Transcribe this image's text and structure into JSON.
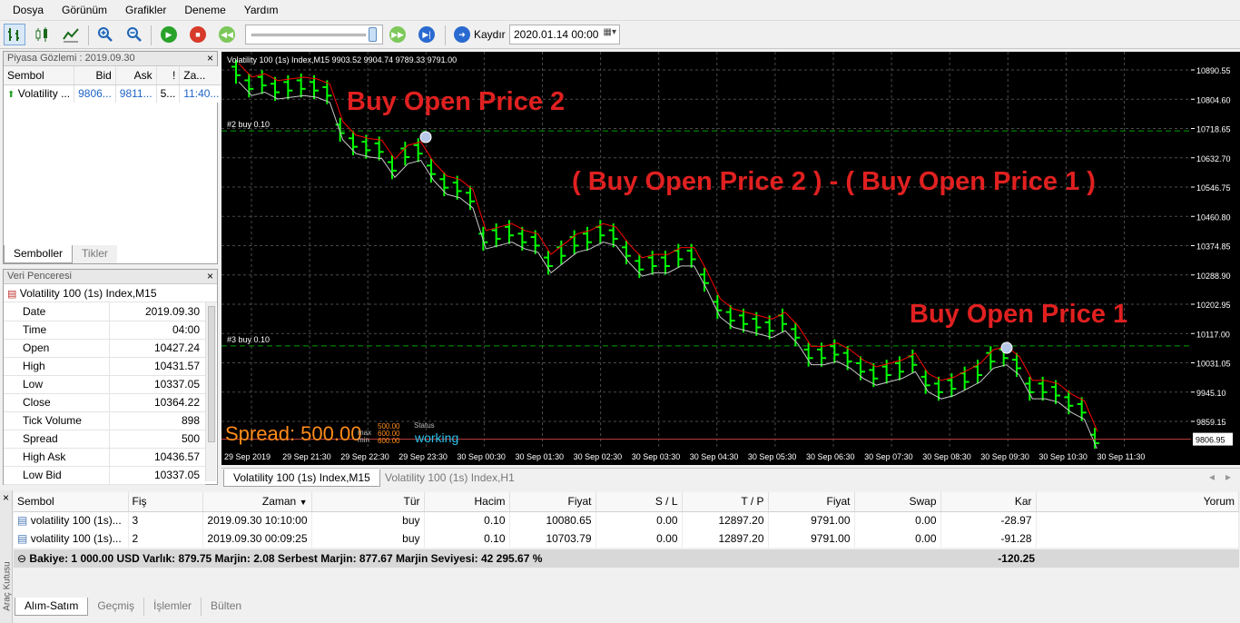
{
  "menu": [
    "Dosya",
    "Görünüm",
    "Grafikler",
    "Deneme",
    "Yardım"
  ],
  "toolbar": {
    "scroll_label": "Kaydır",
    "date_value": "2020.01.14 00:00"
  },
  "market_watch": {
    "title": "Piyasa Gözlemi : 2019.09.30",
    "columns": [
      "Sembol",
      "Bid",
      "Ask",
      "!",
      "Za..."
    ],
    "rows": [
      {
        "symbol": "Volatility ...",
        "bid": "9806...",
        "ask": "9811...",
        "spread": "5...",
        "time": "11:40..."
      }
    ],
    "tabs": [
      "Semboller",
      "Tikler"
    ]
  },
  "data_window": {
    "title": "Veri Penceresi",
    "symbol": "Volatility 100 (1s) Index,M15",
    "rows": [
      {
        "label": "Date",
        "value": "2019.09.30"
      },
      {
        "label": "Time",
        "value": "04:00"
      },
      {
        "label": "Open",
        "value": "10427.24"
      },
      {
        "label": "High",
        "value": "10431.57"
      },
      {
        "label": "Low",
        "value": "10337.05"
      },
      {
        "label": "Close",
        "value": "10364.22"
      },
      {
        "label": "Tick Volume",
        "value": "898"
      },
      {
        "label": "Spread",
        "value": "500"
      },
      {
        "label": "High Ask",
        "value": "10436.57"
      },
      {
        "label": "Low Bid",
        "value": "10337.05"
      }
    ]
  },
  "chart": {
    "header": "Volatility 100 (1s) Index,M15   9903.52 9904.74 9789.33 9791.00",
    "order2_label": "#2 buy 0.10",
    "order3_label": "#3 buy 0.10",
    "annotations": {
      "buy2": "Buy Open Price 2",
      "diff": "( Buy Open Price 2 )  -  ( Buy Open Price 1 )",
      "buy1": "Buy Open Price 1"
    },
    "spread_text": "Spread: 500.00",
    "mini_values": [
      "500.00",
      "600.00",
      "600.00"
    ],
    "mini_labels": [
      "Status",
      "max",
      "min"
    ],
    "status_text": "working",
    "price_labels": [
      "10890.55",
      "10804.60",
      "10718.65",
      "10632.70",
      "10546.75",
      "10460.80",
      "10374.85",
      "10288.90",
      "10202.95",
      "10117.00",
      "10031.05",
      "9945.10",
      "9859.15"
    ],
    "current_price": "9806.95",
    "time_labels": [
      "29 Sep 2019",
      "29 Sep 21:30",
      "29 Sep 22:30",
      "29 Sep 23:30",
      "30 Sep 00:30",
      "30 Sep 01:30",
      "30 Sep 02:30",
      "30 Sep 03:30",
      "30 Sep 04:30",
      "30 Sep 05:30",
      "30 Sep 06:30",
      "30 Sep 07:30",
      "30 Sep 08:30",
      "30 Sep 09:30",
      "30 Sep 10:30",
      "30 Sep 11:30"
    ],
    "colors": {
      "bar": "#00ff00",
      "upper": "#ff0000",
      "lower": "#c8c8c8",
      "grid": "#4a4a4a",
      "order": "#00a000",
      "annotation": "#e02020"
    },
    "bars": [
      10890,
      10850,
      10860,
      10840,
      10845,
      10850,
      10845,
      10830,
      10720,
      10680,
      10670,
      10665,
      10610,
      10650,
      10660,
      10600,
      10560,
      10550,
      10520,
      10400,
      10410,
      10420,
      10400,
      10390,
      10330,
      10360,
      10390,
      10400,
      10420,
      10410,
      10360,
      10320,
      10330,
      10330,
      10350,
      10350,
      10280,
      10200,
      10170,
      10160,
      10150,
      10140,
      10160,
      10120,
      10060,
      10060,
      10070,
      10050,
      10020,
      10000,
      10010,
      10020,
      10040,
      9980,
      9960,
      9970,
      9990,
      10010,
      10050,
      10060,
      10030,
      9960,
      9960,
      9950,
      9920,
      9900,
      9810
    ]
  },
  "chart_tabs": [
    "Volatility 100 (1s) Index,M15",
    "Volatility 100 (1s) Index,H1"
  ],
  "terminal": {
    "side_label": "Araç Kutusu",
    "columns": [
      "Sembol",
      "Fiş",
      "Zaman",
      "Tür",
      "Hacim",
      "Fiyat",
      "S / L",
      "T / P",
      "Fiyat",
      "Swap",
      "Kar",
      "Yorum"
    ],
    "rows": [
      {
        "symbol": "volatility 100 (1s)...",
        "ticket": "3",
        "time": "2019.09.30 10:10:00",
        "type": "buy",
        "volume": "0.10",
        "price": "10080.65",
        "sl": "0.00",
        "tp": "12897.20",
        "cur": "9791.00",
        "swap": "0.00",
        "profit": "-28.97"
      },
      {
        "symbol": "volatility 100 (1s)...",
        "ticket": "2",
        "time": "2019.09.30 00:09:25",
        "type": "buy",
        "volume": "0.10",
        "price": "10703.79",
        "sl": "0.00",
        "tp": "12897.20",
        "cur": "9791.00",
        "swap": "0.00",
        "profit": "-91.28"
      }
    ],
    "summary": "Bakiye: 1 000.00 USD  Varlık: 879.75  Marjin: 2.08  Serbest Marjin: 877.67  Marjin Seviyesi: 42 295.67 %",
    "total": "-120.25",
    "tabs": [
      "Alım-Satım",
      "Geçmiş",
      "İşlemler",
      "Bülten"
    ]
  }
}
